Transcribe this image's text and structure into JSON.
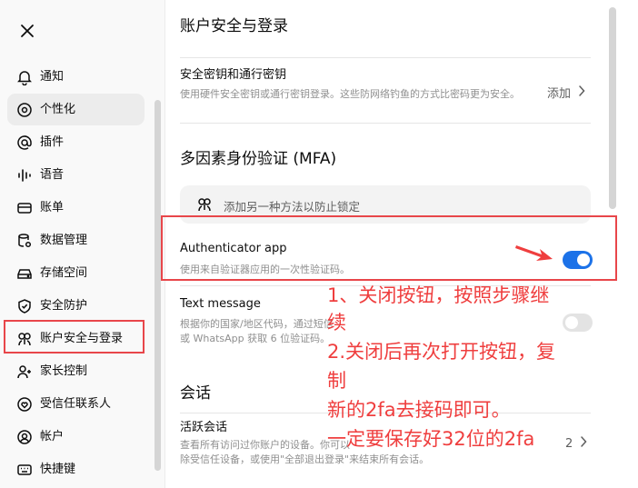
{
  "sidebar": {
    "close_icon": "close-icon",
    "items": [
      {
        "label": "通知",
        "icon": "bell-icon"
      },
      {
        "label": "个性化",
        "icon": "sliders-icon"
      },
      {
        "label": "插件",
        "icon": "at-icon"
      },
      {
        "label": "语音",
        "icon": "waveform-icon"
      },
      {
        "label": "账单",
        "icon": "card-icon"
      },
      {
        "label": "数据管理",
        "icon": "database-gear-icon"
      },
      {
        "label": "存储空间",
        "icon": "storage-icon"
      },
      {
        "label": "安全防护",
        "icon": "shield-icon"
      },
      {
        "label": "账户安全与登录",
        "icon": "lock-people-icon"
      },
      {
        "label": "家长控制",
        "icon": "person-plus-icon"
      },
      {
        "label": "受信任联系人",
        "icon": "contact-heart-icon"
      },
      {
        "label": "帐户",
        "icon": "user-circle-icon"
      },
      {
        "label": "快捷键",
        "icon": "keyboard-icon"
      }
    ]
  },
  "main": {
    "title": "账户安全与登录",
    "passkeys": {
      "title": "安全密钥和通行密钥",
      "desc": "使用硬件安全密钥或通行密钥登录。这些防网络钓鱼的方式比密码更为安全。",
      "action": "添加"
    },
    "mfa": {
      "heading": "多因素身份验证 (MFA)",
      "add_method": "添加另一种方法以防止锁定",
      "authenticator": {
        "title": "Authenticator app",
        "desc": "使用来自验证器应用的一次性验证码。",
        "enabled": true
      },
      "text_message": {
        "title": "Text message",
        "desc_line1": "根据你的国家/地区代码，通过短信",
        "desc_line2": "或 WhatsApp 获取 6 位验证码。",
        "enabled": false
      }
    },
    "sessions": {
      "heading": "会话",
      "active_title": "活跃会话",
      "active_desc_line1": "查看所有访问过你账户的设备。你可以",
      "active_desc_line2": "除受信任设备，或使用\"全部退出登录\"来结束所有会话。",
      "count": "2"
    }
  },
  "annotation": {
    "lines": [
      "1、关闭按钮，按照步骤继",
      "续",
      "2.关闭后再次打开按钮，复",
      "制",
      "新的2fa去接码即可。",
      "一定要保存好32位的2fa"
    ],
    "color": "#ef3e3e"
  },
  "colors": {
    "toggle_on": "#1c72e8",
    "highlight": "#e8464a"
  }
}
